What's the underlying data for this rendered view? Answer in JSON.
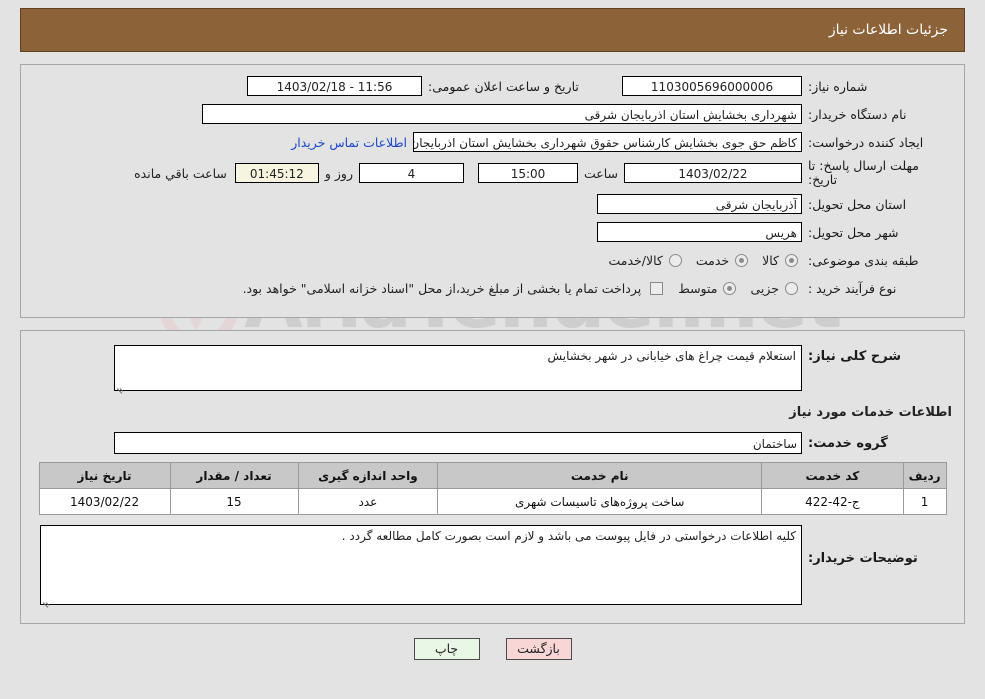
{
  "header": {
    "title": "جزئیات اطلاعات نیاز"
  },
  "top_form": {
    "need_number_label": "شماره نیاز:",
    "need_number_value": "1103005696000006",
    "public_announce_label": "تاریخ و ساعت اعلان عمومی:",
    "public_announce_value": "11:56 - 1403/02/18",
    "buyer_org_label": "نام دستگاه خریدار:",
    "buyer_org_value": "شهرداری بخشایش استان اذربایجان شرقی",
    "creator_label": "ایجاد کننده درخواست:",
    "creator_value": "کاظم حق جوی بخشایش کارشناس حقوق شهرداری بخشایش استان اذربایجان",
    "contact_link": "اطلاعات تماس خریدار",
    "deadline_label": "مهلت ارسال پاسخ: تا تاریخ:",
    "deadline_date": "1403/02/22",
    "hour_label": "ساعت",
    "deadline_time": "15:00",
    "days_remaining": "4",
    "days_label": "روز و",
    "countdown": "01:45:12",
    "remaining_suffix": "ساعت باقي مانده",
    "province_label": "استان محل تحویل:",
    "province_value": "آذربایجان شرقی",
    "city_label": "شهر محل تحویل:",
    "city_value": "هریس",
    "category_label": "طبقه بندی موضوعی:",
    "category_options": [
      {
        "label": "کالا",
        "selected": false
      },
      {
        "label": "خدمت",
        "selected": true
      },
      {
        "label": "کالا/خدمت",
        "selected": false
      }
    ],
    "process_label": "نوع فرآیند خرید :",
    "process_options": [
      {
        "label": "جزیی",
        "selected": false
      },
      {
        "label": "متوسط",
        "selected": false
      }
    ],
    "treasury_checkbox_checked": false,
    "treasury_note": "پرداخت تمام یا بخشی از مبلغ خرید،از محل \"اسناد خزانه اسلامی\" خواهد بود."
  },
  "mid_form": {
    "general_desc_label": "شرح کلی نیاز:",
    "general_desc_value": "استعلام قیمت چراغ های خیابانی در شهر بخشایش",
    "services_section_title": "اطلاعات خدمات مورد نیاز",
    "service_group_label": "گروه خدمت:",
    "service_group_value": "ساختمان",
    "table": {
      "columns": [
        "ردیف",
        "کد خدمت",
        "نام خدمت",
        "واحد اندازه گیری",
        "تعداد / مقدار",
        "تاریخ نیاز"
      ],
      "rows": [
        {
          "radif": "1",
          "code": "ج-42-422",
          "name": "ساخت پروژه‌های تاسیسات شهری",
          "unit": "عدد",
          "quantity": "15",
          "date": "1403/02/22"
        }
      ]
    },
    "buyer_notes_label": "توضیحات خریدار:",
    "buyer_notes_value": "کلیه اطلاعات درخواستی در فایل پیوست می باشد و لازم است بصورت کامل مطالعه گردد ."
  },
  "footer": {
    "back_button": "بازگشت",
    "print_button": "چاپ"
  },
  "watermark": {
    "text": "AriaTender.net"
  },
  "colors": {
    "header_bg": "#8c6239",
    "page_bg": "#e3e3e3",
    "link": "#1c48c8",
    "back_btn": "#f9d6d6",
    "print_btn": "#e9f7e6",
    "countdown_bg": "#f7f5e0",
    "table_header_bg": "#c8c8c8"
  }
}
